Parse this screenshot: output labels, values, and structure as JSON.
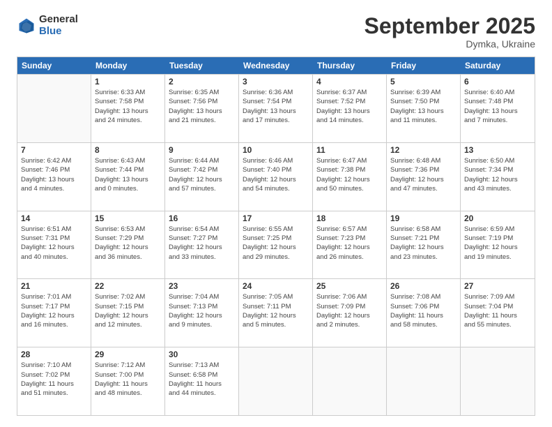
{
  "logo": {
    "general": "General",
    "blue": "Blue"
  },
  "title": "September 2025",
  "subtitle": "Dymka, Ukraine",
  "header_days": [
    "Sunday",
    "Monday",
    "Tuesday",
    "Wednesday",
    "Thursday",
    "Friday",
    "Saturday"
  ],
  "weeks": [
    [
      {
        "day": "",
        "info": ""
      },
      {
        "day": "1",
        "info": "Sunrise: 6:33 AM\nSunset: 7:58 PM\nDaylight: 13 hours\nand 24 minutes."
      },
      {
        "day": "2",
        "info": "Sunrise: 6:35 AM\nSunset: 7:56 PM\nDaylight: 13 hours\nand 21 minutes."
      },
      {
        "day": "3",
        "info": "Sunrise: 6:36 AM\nSunset: 7:54 PM\nDaylight: 13 hours\nand 17 minutes."
      },
      {
        "day": "4",
        "info": "Sunrise: 6:37 AM\nSunset: 7:52 PM\nDaylight: 13 hours\nand 14 minutes."
      },
      {
        "day": "5",
        "info": "Sunrise: 6:39 AM\nSunset: 7:50 PM\nDaylight: 13 hours\nand 11 minutes."
      },
      {
        "day": "6",
        "info": "Sunrise: 6:40 AM\nSunset: 7:48 PM\nDaylight: 13 hours\nand 7 minutes."
      }
    ],
    [
      {
        "day": "7",
        "info": "Sunrise: 6:42 AM\nSunset: 7:46 PM\nDaylight: 13 hours\nand 4 minutes."
      },
      {
        "day": "8",
        "info": "Sunrise: 6:43 AM\nSunset: 7:44 PM\nDaylight: 13 hours\nand 0 minutes."
      },
      {
        "day": "9",
        "info": "Sunrise: 6:44 AM\nSunset: 7:42 PM\nDaylight: 12 hours\nand 57 minutes."
      },
      {
        "day": "10",
        "info": "Sunrise: 6:46 AM\nSunset: 7:40 PM\nDaylight: 12 hours\nand 54 minutes."
      },
      {
        "day": "11",
        "info": "Sunrise: 6:47 AM\nSunset: 7:38 PM\nDaylight: 12 hours\nand 50 minutes."
      },
      {
        "day": "12",
        "info": "Sunrise: 6:48 AM\nSunset: 7:36 PM\nDaylight: 12 hours\nand 47 minutes."
      },
      {
        "day": "13",
        "info": "Sunrise: 6:50 AM\nSunset: 7:34 PM\nDaylight: 12 hours\nand 43 minutes."
      }
    ],
    [
      {
        "day": "14",
        "info": "Sunrise: 6:51 AM\nSunset: 7:31 PM\nDaylight: 12 hours\nand 40 minutes."
      },
      {
        "day": "15",
        "info": "Sunrise: 6:53 AM\nSunset: 7:29 PM\nDaylight: 12 hours\nand 36 minutes."
      },
      {
        "day": "16",
        "info": "Sunrise: 6:54 AM\nSunset: 7:27 PM\nDaylight: 12 hours\nand 33 minutes."
      },
      {
        "day": "17",
        "info": "Sunrise: 6:55 AM\nSunset: 7:25 PM\nDaylight: 12 hours\nand 29 minutes."
      },
      {
        "day": "18",
        "info": "Sunrise: 6:57 AM\nSunset: 7:23 PM\nDaylight: 12 hours\nand 26 minutes."
      },
      {
        "day": "19",
        "info": "Sunrise: 6:58 AM\nSunset: 7:21 PM\nDaylight: 12 hours\nand 23 minutes."
      },
      {
        "day": "20",
        "info": "Sunrise: 6:59 AM\nSunset: 7:19 PM\nDaylight: 12 hours\nand 19 minutes."
      }
    ],
    [
      {
        "day": "21",
        "info": "Sunrise: 7:01 AM\nSunset: 7:17 PM\nDaylight: 12 hours\nand 16 minutes."
      },
      {
        "day": "22",
        "info": "Sunrise: 7:02 AM\nSunset: 7:15 PM\nDaylight: 12 hours\nand 12 minutes."
      },
      {
        "day": "23",
        "info": "Sunrise: 7:04 AM\nSunset: 7:13 PM\nDaylight: 12 hours\nand 9 minutes."
      },
      {
        "day": "24",
        "info": "Sunrise: 7:05 AM\nSunset: 7:11 PM\nDaylight: 12 hours\nand 5 minutes."
      },
      {
        "day": "25",
        "info": "Sunrise: 7:06 AM\nSunset: 7:09 PM\nDaylight: 12 hours\nand 2 minutes."
      },
      {
        "day": "26",
        "info": "Sunrise: 7:08 AM\nSunset: 7:06 PM\nDaylight: 11 hours\nand 58 minutes."
      },
      {
        "day": "27",
        "info": "Sunrise: 7:09 AM\nSunset: 7:04 PM\nDaylight: 11 hours\nand 55 minutes."
      }
    ],
    [
      {
        "day": "28",
        "info": "Sunrise: 7:10 AM\nSunset: 7:02 PM\nDaylight: 11 hours\nand 51 minutes."
      },
      {
        "day": "29",
        "info": "Sunrise: 7:12 AM\nSunset: 7:00 PM\nDaylight: 11 hours\nand 48 minutes."
      },
      {
        "day": "30",
        "info": "Sunrise: 7:13 AM\nSunset: 6:58 PM\nDaylight: 11 hours\nand 44 minutes."
      },
      {
        "day": "",
        "info": ""
      },
      {
        "day": "",
        "info": ""
      },
      {
        "day": "",
        "info": ""
      },
      {
        "day": "",
        "info": ""
      }
    ]
  ]
}
